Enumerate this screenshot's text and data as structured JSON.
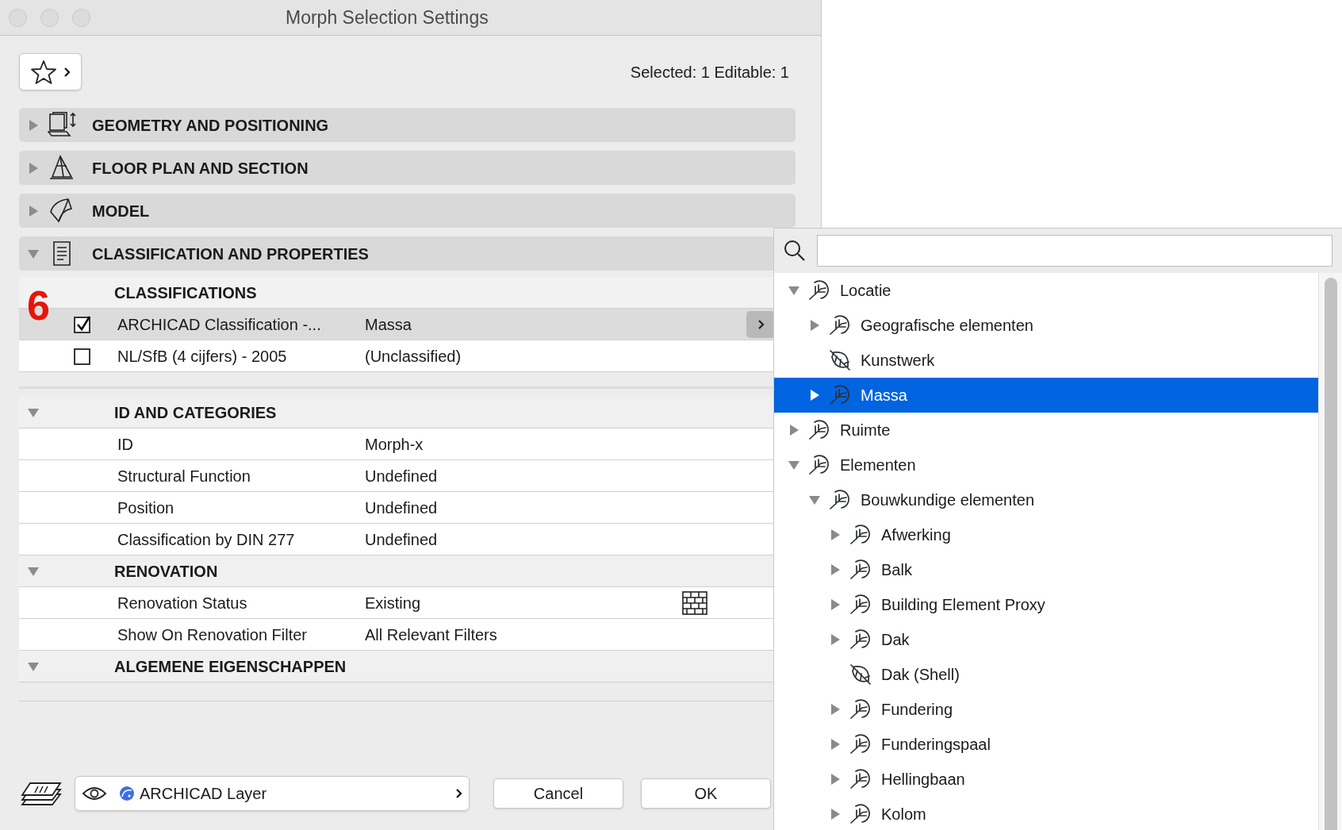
{
  "window": {
    "title": "Morph Selection Settings"
  },
  "selection_info": "Selected: 1 Editable: 1",
  "panels": [
    {
      "title": "GEOMETRY AND POSITIONING",
      "expanded": false
    },
    {
      "title": "FLOOR PLAN AND SECTION",
      "expanded": false
    },
    {
      "title": "MODEL",
      "expanded": false
    },
    {
      "title": "CLASSIFICATION AND PROPERTIES",
      "expanded": true
    }
  ],
  "classifications": {
    "title": "CLASSIFICATIONS",
    "annotation": "6",
    "rows": [
      {
        "system": "ARCHICAD Classification -...",
        "value": "Massa",
        "checked": true,
        "selected": true
      },
      {
        "system": "NL/SfB (4 cijfers) - 2005",
        "value": "(Unclassified)",
        "checked": false,
        "selected": false
      }
    ]
  },
  "property_groups": [
    {
      "title": "ID AND CATEGORIES",
      "expanded": true,
      "rows": [
        {
          "name": "ID",
          "value": "Morph-x",
          "kind": "plain"
        },
        {
          "name": "Structural Function",
          "value": "Undefined",
          "kind": "plain"
        },
        {
          "name": "Position",
          "value": "Undefined",
          "kind": "plain"
        },
        {
          "name": "Classification by DIN 277",
          "value": "Undefined",
          "kind": "plain"
        }
      ]
    },
    {
      "title": "RENOVATION",
      "expanded": true,
      "rows": [
        {
          "name": "Renovation Status",
          "value": "Existing",
          "kind": "status"
        },
        {
          "name": "Show On Renovation Filter",
          "value": "All Relevant Filters",
          "kind": "plain"
        }
      ]
    },
    {
      "title": "ALGEMENE EIGENSCHAPPEN",
      "expanded": true
    }
  ],
  "footer": {
    "layer": "ARCHICAD Layer",
    "buttons": [
      "Cancel",
      "OK"
    ]
  },
  "popup": {
    "tree": [
      {
        "label": "Locatie",
        "kind": "branch",
        "expanded": true,
        "selected": false,
        "children": [
          {
            "label": "Geografische elementen",
            "kind": "branch",
            "expanded": false,
            "selected": false
          },
          {
            "label": "Kunstwerk",
            "kind": "leaf",
            "selected": false
          },
          {
            "label": "Massa",
            "kind": "branch",
            "expanded": false,
            "selected": true
          }
        ]
      },
      {
        "label": "Ruimte",
        "kind": "branch",
        "expanded": false,
        "selected": false
      },
      {
        "label": "Elementen",
        "kind": "branch",
        "expanded": true,
        "selected": false,
        "children": [
          {
            "label": "Bouwkundige elementen",
            "kind": "branch",
            "expanded": true,
            "selected": false,
            "children": [
              {
                "label": "Afwerking",
                "kind": "branch",
                "expanded": false,
                "selected": false
              },
              {
                "label": "Balk",
                "kind": "branch",
                "expanded": false,
                "selected": false
              },
              {
                "label": "Building Element Proxy",
                "kind": "branch",
                "expanded": false,
                "selected": false
              },
              {
                "label": "Dak",
                "kind": "branch",
                "expanded": false,
                "selected": false
              },
              {
                "label": "Dak (Shell)",
                "kind": "leaf",
                "selected": false
              },
              {
                "label": "Fundering",
                "kind": "branch",
                "expanded": false,
                "selected": false
              },
              {
                "label": "Funderingspaal",
                "kind": "branch",
                "expanded": false,
                "selected": false
              },
              {
                "label": "Hellingbaan",
                "kind": "branch",
                "expanded": false,
                "selected": false
              },
              {
                "label": "Kolom",
                "kind": "branch",
                "expanded": false,
                "selected": false
              }
            ]
          }
        ]
      }
    ]
  }
}
